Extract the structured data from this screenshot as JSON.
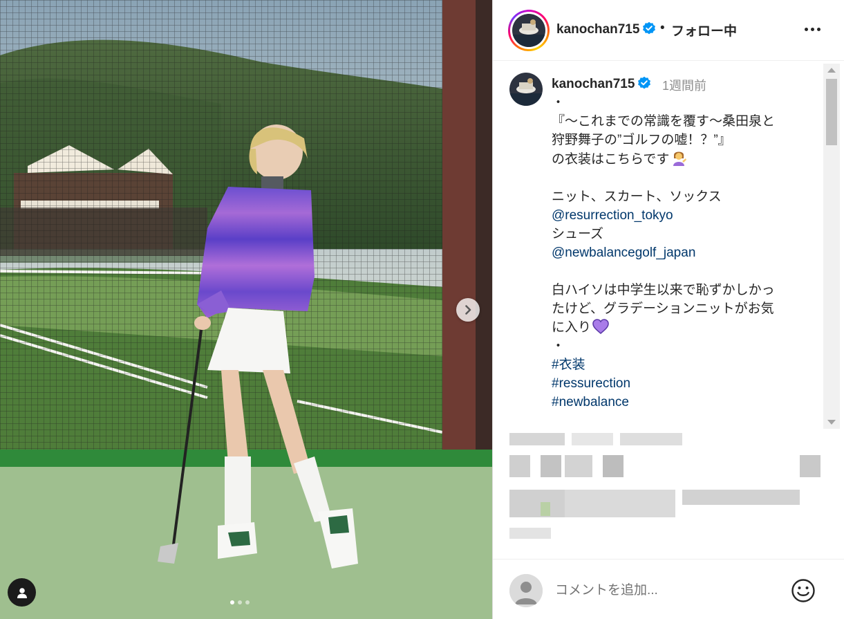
{
  "header": {
    "username": "kanochan715",
    "separator": "•",
    "follow_status": "フォロー中",
    "more_icon": "more-horizontal-icon"
  },
  "caption": {
    "username": "kanochan715",
    "time": "1週間前",
    "lines": [
      {
        "text": "・",
        "type": "text"
      },
      {
        "text": "『～これまでの常識を覆す～桑田泉と",
        "type": "text"
      },
      {
        "text": "狩野舞子の”ゴルフの嘘！？”』",
        "type": "text"
      },
      {
        "text": "の衣装はこちらです",
        "type": "text",
        "emoji": "person-tipping-hand-emoji"
      },
      {
        "text": "",
        "type": "blank"
      },
      {
        "text": "ニット、スカート、ソックス",
        "type": "text"
      },
      {
        "text": "@resurrection_tokyo",
        "type": "link"
      },
      {
        "text": "シューズ",
        "type": "text"
      },
      {
        "text": "@newbalancegolf_japan",
        "type": "link"
      },
      {
        "text": "",
        "type": "blank"
      },
      {
        "text": "白ハイソは中学生以来で恥ずかしかっ",
        "type": "text"
      },
      {
        "text": "たけど、グラデーションニットがお気",
        "type": "text"
      },
      {
        "text": "に入り",
        "type": "text",
        "emoji": "purple-heart-emoji"
      },
      {
        "text": "・",
        "type": "text"
      },
      {
        "text": "#衣装",
        "type": "link"
      },
      {
        "text": "#ressurection",
        "type": "link"
      },
      {
        "text": "#newbalance",
        "type": "link"
      }
    ]
  },
  "comment": {
    "placeholder": "コメントを追加...",
    "value": "",
    "emoji_icon": "smiley-face-icon"
  },
  "carousel": {
    "slide_count": 3,
    "active_index": 0,
    "next_icon": "chevron-right-icon",
    "tag_icon": "user-tag-icon"
  },
  "colors": {
    "link": "#00376b",
    "text": "#262626",
    "muted": "#8e8e8e",
    "verified": "#0095f6"
  }
}
